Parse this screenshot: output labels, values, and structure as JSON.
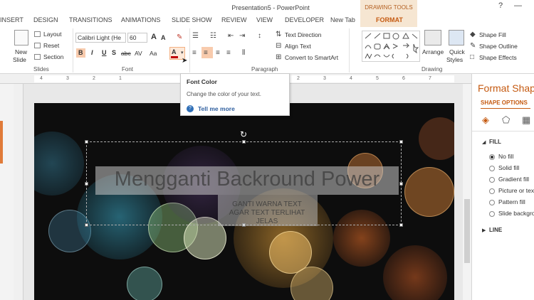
{
  "app": {
    "title": "Presentation5 - PowerPoint",
    "drawing_tools": "DRAWING TOOLS",
    "window_help": "?",
    "window_min": "—"
  },
  "tabs": [
    "INSERT",
    "DESIGN",
    "TRANSITIONS",
    "ANIMATIONS",
    "SLIDE SHOW",
    "REVIEW",
    "VIEW",
    "DEVELOPER",
    "New Tab",
    "FORMAT"
  ],
  "ribbon": {
    "slides": {
      "new_slide": "New",
      "new_slide_2": "Slide",
      "layout": "Layout",
      "reset": "Reset",
      "section": "Section",
      "label": "Slides"
    },
    "font": {
      "family": "Calibri Light (He",
      "size": "60",
      "bold": "B",
      "italic": "I",
      "underline": "U",
      "shadow": "S",
      "strike": "abc",
      "spacing": "AV",
      "case": "Aa",
      "color": "A",
      "label": "Font"
    },
    "paragraph": {
      "text_direction": "Text Direction",
      "align_text": "Align Text",
      "smartart": "Convert to SmartArt",
      "label": "Paragraph"
    },
    "drawing": {
      "arrange": "Arrange",
      "quick_styles": "Quick",
      "quick_styles_2": "Styles",
      "shape_fill": "Shape Fill",
      "shape_outline": "Shape Outline",
      "shape_effects": "Shape Effects",
      "label": "Drawing"
    }
  },
  "ruler_ticks": [
    "4",
    "3",
    "2",
    "1",
    "0",
    "1",
    "2",
    "3",
    "4",
    "5",
    "6",
    "7"
  ],
  "tooltip": {
    "title": "Font Color",
    "description": "Change the color of your text.",
    "help": "Tell me more"
  },
  "slide": {
    "title": "Mengganti Backround Power",
    "body": [
      "GANTI WARNA TEXT",
      "AGAR TEXT TERLIHAT",
      "JELAS"
    ]
  },
  "pane": {
    "title": "Format Shap",
    "tab": "SHAPE OPTIONS",
    "fill_header": "FILL",
    "line_header": "LINE",
    "options": [
      "No fill",
      "Solid fill",
      "Gradient fill",
      "Picture or tex",
      "Pattern fill",
      "Slide backgro"
    ],
    "selected": "No fill"
  },
  "colors": {
    "accent": "#c55a11",
    "tab_highlight": "#f6e6d2",
    "slide_bg": "#0d0d0d"
  }
}
